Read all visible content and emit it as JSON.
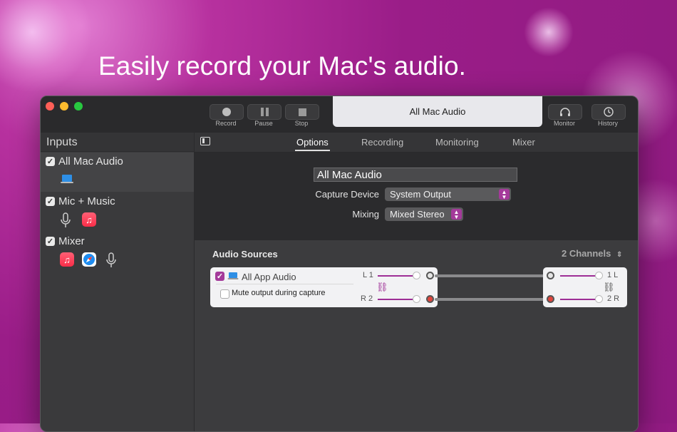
{
  "headline": "Easily record your Mac's audio.",
  "toolbar": {
    "record_label": "Record",
    "pause_label": "Pause",
    "stop_label": "Stop",
    "title": "All Mac Audio",
    "monitor_label": "Monitor",
    "history_label": "History"
  },
  "sidebar": {
    "header": "Inputs",
    "items": [
      {
        "name": "All Mac Audio",
        "checked": true,
        "icons": [
          "laptop-icon"
        ]
      },
      {
        "name": "Mic + Music",
        "checked": true,
        "icons": [
          "microphone-icon",
          "music-app-icon"
        ]
      },
      {
        "name": "Mixer",
        "checked": true,
        "icons": [
          "music-app-icon",
          "safari-icon",
          "microphone-icon"
        ]
      }
    ]
  },
  "tabs": [
    "Options",
    "Recording",
    "Monitoring",
    "Mixer"
  ],
  "active_tab": "Options",
  "options": {
    "source_name": "All Mac Audio",
    "capture_device_label": "Capture Device",
    "capture_device_value": "System Output",
    "mixing_label": "Mixing",
    "mixing_value": "Mixed Stereo"
  },
  "audio_sources": {
    "title": "Audio Sources",
    "channels": "2 Channels",
    "source": {
      "name": "All App Audio",
      "checked": true,
      "mute_label": "Mute output during capture",
      "mute_checked": false,
      "left_label": "L 1",
      "right_label": "R 2"
    },
    "output": {
      "left_label": "1 L",
      "right_label": "2 R"
    }
  },
  "colors": {
    "background": "#9a1d88",
    "accent": "#a43a9a",
    "window": "#3c3c3e"
  }
}
